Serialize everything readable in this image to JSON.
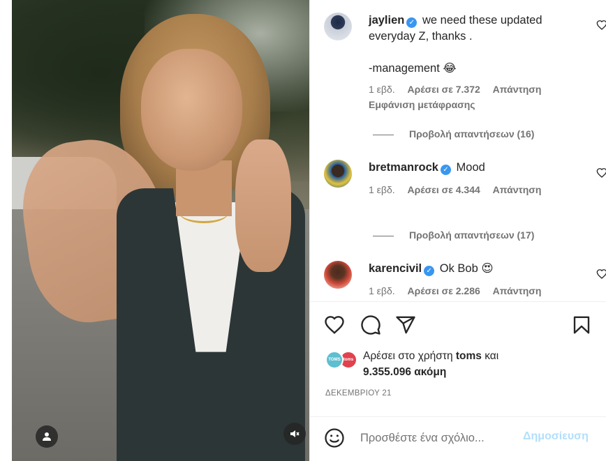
{
  "media": {
    "user_icon": "user-icon",
    "mute_icon": "speaker-muted-icon"
  },
  "comments": [
    {
      "username": "jaylien",
      "text_line1": "we need these updated",
      "text_line2": "everyday Z, thanks .",
      "text_line3": "-management 😂",
      "time": "1 εβδ.",
      "likes": "Αρέσει σε 7.372",
      "reply": "Απάντηση",
      "translation": "Εμφάνιση μετάφρασης",
      "view_replies": "Προβολή απαντήσεων (16)"
    },
    {
      "username": "bretmanrock",
      "text": "Mood",
      "time": "1 εβδ.",
      "likes": "Αρέσει σε 4.344",
      "reply": "Απάντηση",
      "view_replies": "Προβολή απαντήσεων (17)"
    },
    {
      "username": "karencivil",
      "text": "Ok Bob 😍",
      "time": "1 εβδ.",
      "likes": "Αρέσει σε 2.286",
      "reply": "Απάντηση"
    }
  ],
  "actions": {
    "like_icon": "heart-icon",
    "comment_icon": "comment-icon",
    "share_icon": "share-icon",
    "save_icon": "bookmark-icon"
  },
  "likes": {
    "avatar_a_label": "TOMS",
    "avatar_b_label": "toms",
    "prefix": "Αρέσει στο χρήστη",
    "user": "toms",
    "conj": "και",
    "count": "9.355.096 ακόμη"
  },
  "date": "ΔΕΚΕΜΒΡΙΟΥ 21",
  "add_comment": {
    "placeholder": "Προσθέστε ένα σχόλιο...",
    "post_label": "Δημοσίευση"
  }
}
